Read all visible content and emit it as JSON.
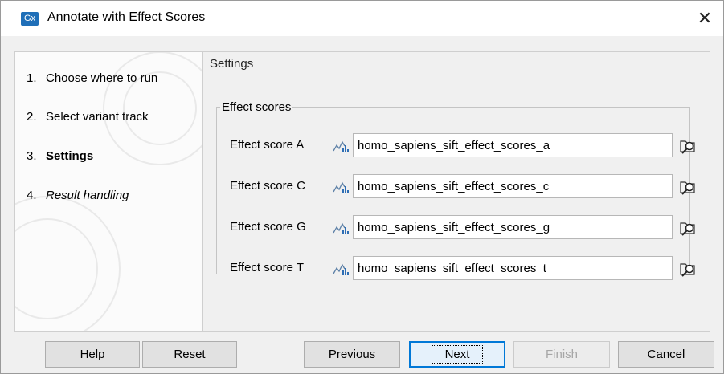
{
  "window": {
    "app_icon": "Gx",
    "title": "Annotate with Effect Scores",
    "close_glyph": "✕"
  },
  "steps": [
    {
      "num": "1.",
      "label": "Choose where to run",
      "state": "normal"
    },
    {
      "num": "2.",
      "label": "Select variant track",
      "state": "normal"
    },
    {
      "num": "3.",
      "label": "Settings",
      "state": "current"
    },
    {
      "num": "4.",
      "label": "Result handling",
      "state": "italic"
    }
  ],
  "settings": {
    "title": "Settings",
    "group_title": "Effect scores",
    "rows": [
      {
        "label": "Effect score A",
        "value": "homo_sapiens_sift_effect_scores_a"
      },
      {
        "label": "Effect score C",
        "value": "homo_sapiens_sift_effect_scores_c"
      },
      {
        "label": "Effect score G",
        "value": "homo_sapiens_sift_effect_scores_g"
      },
      {
        "label": "Effect score T",
        "value": "homo_sapiens_sift_effect_scores_t"
      }
    ],
    "track_icon": "effect-score-track-icon",
    "browse_icon": "browse-folder-icon"
  },
  "buttons": {
    "help": "Help",
    "reset": "Reset",
    "previous": "Previous",
    "next": "Next",
    "finish": "Finish",
    "cancel": "Cancel"
  },
  "colors": {
    "accent": "#0078d7",
    "logo": "#1f6fb8"
  }
}
